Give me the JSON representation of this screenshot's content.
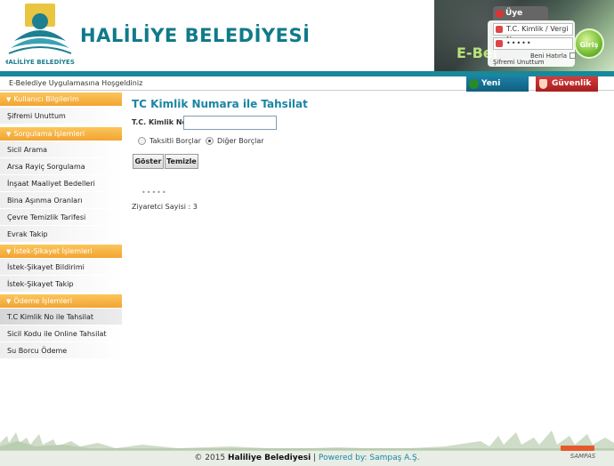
{
  "header": {
    "brand_title": "HALİLİYE BELEDİYESİ",
    "logo_text": "HALİLİYE BELEDİYESİ",
    "ebelediye_text": "E-Bel"
  },
  "login": {
    "tab_label": "Üye Girişi",
    "tc_placeholder": "T.C. Kimlik / Vergi No",
    "password_mask": "•••••",
    "remember_label": "Beni Hatırla",
    "forgot_label": "Şifremi Unuttum",
    "submit_label": "Giriş"
  },
  "welcome": {
    "text": "E-Belediye Uygulamasına Hoşgeldiniz",
    "new_member_label": "Yeni Üyelik",
    "security_label": "Güvenlik"
  },
  "sidebar": {
    "sections": [
      {
        "title": "Kullanıcı Bilgilerim",
        "items": [
          "Şifremi Unuttum"
        ]
      },
      {
        "title": "Sorgulama İşlemleri",
        "items": [
          "Sicil Arama",
          "Arsa Rayiç Sorgulama",
          "İnşaat Maaliyet Bedelleri",
          "Bina Aşınma Oranları",
          "Çevre Temizlik Tarifesi",
          "Evrak Takip"
        ]
      },
      {
        "title": "İstek-Şikayet İşlemleri",
        "items": [
          "İstek-Şikayet Bildirimi",
          "İstek-Şikayet Takip"
        ]
      },
      {
        "title": "Ödeme İşlemleri",
        "items": [
          "T.C Kimlik No ile Tahsilat",
          "Sicil Kodu ile Online Tahsilat",
          "Su Borcu Ödeme"
        ]
      }
    ],
    "active_item": "T.C Kimlik No ile Tahsilat"
  },
  "main": {
    "title": "TC Kimlik Numara ile Tahsilat",
    "tc_label": "T.C. Kimlik No",
    "tc_value": "",
    "radio_installment": "Taksitli Borçlar",
    "radio_other": "Diğer Borçlar",
    "selected_radio": "Diğer Borçlar",
    "show_button": "Göster",
    "clear_button": "Temizle",
    "dots": "•••••",
    "visitor_label": "Ziyaretci Sayisi :",
    "visitor_count": "3"
  },
  "footer": {
    "copyright": "© 2015",
    "org": "Haliliye Belediyesi",
    "separator": "|",
    "powered_by": "Powered by: Sampaş A.Ş.",
    "sampas_logo": "SAMPAS"
  },
  "colors": {
    "accent_teal": "#18889a",
    "title_blue": "#1b85a3",
    "sidebar_header_orange": "#f19a1c",
    "security_red": "#d63a3a",
    "new_member_blue": "#1c7fa6"
  },
  "icons": [
    "user-icon",
    "key-icon",
    "lock-icon",
    "new-user-icon",
    "shield-icon"
  ]
}
